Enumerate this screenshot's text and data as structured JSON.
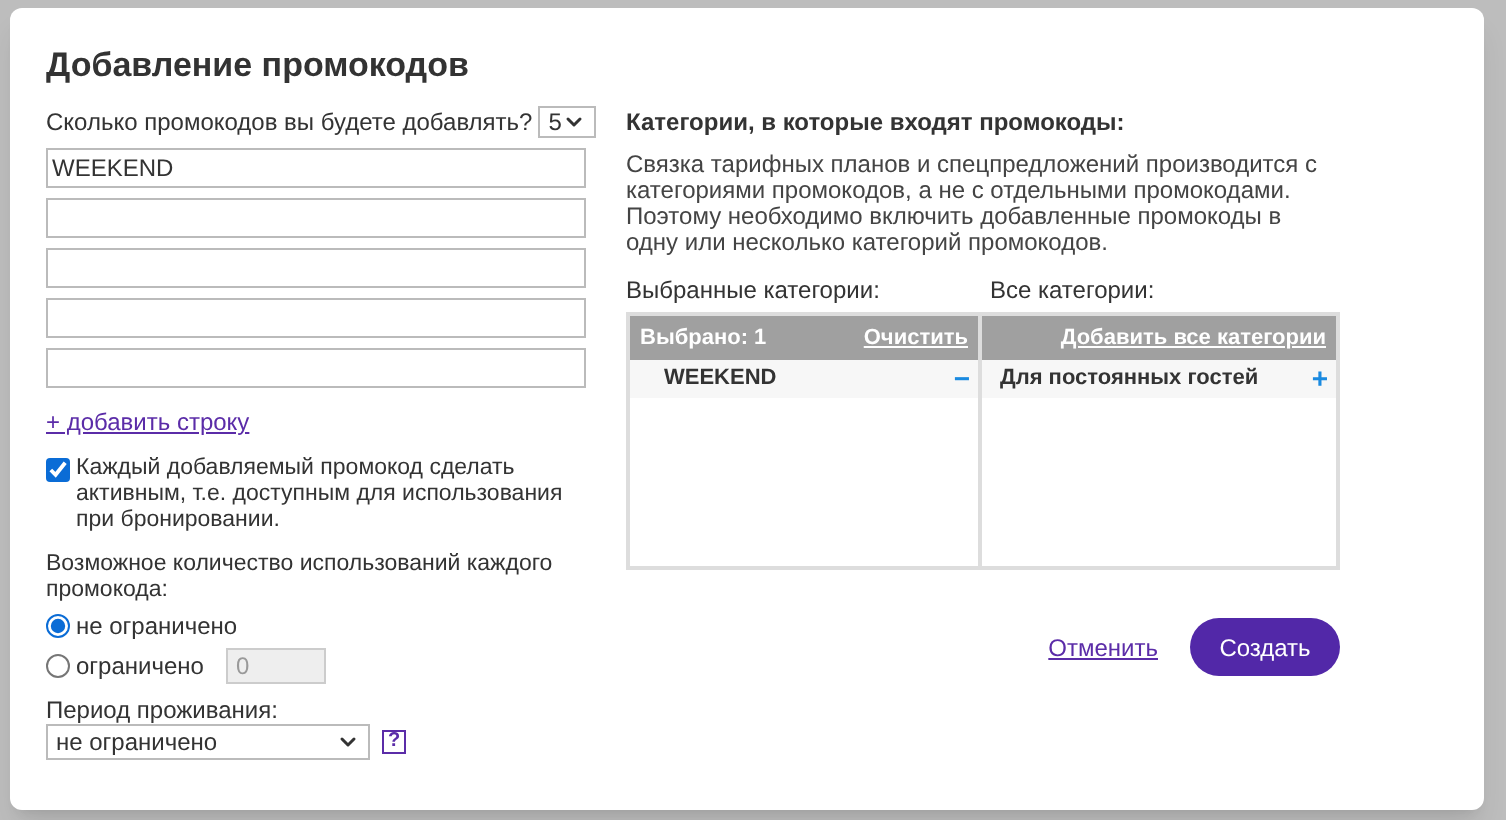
{
  "dialog": {
    "title": "Добавление промокодов"
  },
  "count": {
    "label": "Сколько промокодов вы будете добавлять?",
    "value": "5"
  },
  "codes": [
    {
      "kind": "filled",
      "value": "WEEKEND"
    },
    {
      "kind": "empty"
    },
    {
      "kind": "empty"
    },
    {
      "kind": "empty"
    },
    {
      "kind": "empty"
    }
  ],
  "add_row_link": "+ добавить строку",
  "activate": {
    "checked": true,
    "label": "Каждый добавляемый промокод сделать активным, т.е. доступным для использования при бронировании."
  },
  "usage": {
    "label": "Возможное количество использований каждого промокода:",
    "options": [
      {
        "label": "не ограничено",
        "selected": true
      },
      {
        "label": "ограничено",
        "selected": false,
        "limit": "0"
      }
    ]
  },
  "period": {
    "label": "Период проживания:",
    "value": "не ограничено",
    "help": "?"
  },
  "categories": {
    "heading": "Категории, в которые входят промокоды:",
    "description": "Связка тарифных планов и спецпредложений производится с категориями промокодов, а не с отдельными промокодами. Поэтому необходимо включить добавленные промокоды в одну или несколько категорий промокодов.",
    "selected_label": "Выбранные категории:",
    "all_label": "Все категории:",
    "selected_count": "Выбрано: 1",
    "clear_link": "Очистить",
    "add_all_link": "Добавить все категории",
    "selected": [
      {
        "name": "WEEKEND",
        "action": "−"
      }
    ],
    "all": [
      {
        "name": "Для постоянных гостей",
        "action": "+"
      }
    ]
  },
  "buttons": {
    "cancel": "Отменить",
    "create": "Создать"
  }
}
